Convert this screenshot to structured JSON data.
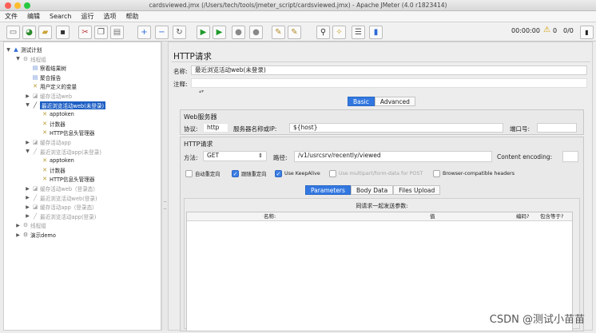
{
  "window": {
    "title": "cardsviewed.jmx (/Users/tech/tools/jmeter_script/cardsviewed.jmx) - Apache JMeter (4.0 r1823414)",
    "traffic_colors": [
      "#fc5f57",
      "#fdbc2e",
      "#28c840"
    ]
  },
  "menu": [
    "文件",
    "编辑",
    "Search",
    "运行",
    "选项",
    "帮助"
  ],
  "toolbar": {
    "buttons": [
      {
        "name": "new-icon",
        "glyph": "▭",
        "color": "#666"
      },
      {
        "name": "templates-icon",
        "glyph": "◕",
        "color": "#2a8a2a"
      },
      {
        "name": "open-icon",
        "glyph": "▰",
        "color": "#c9a233"
      },
      {
        "name": "save-icon",
        "glyph": "▪",
        "color": "#333"
      },
      {
        "name": "cut-icon",
        "glyph": "✂",
        "color": "#b33"
      },
      {
        "name": "copy-icon",
        "glyph": "❐",
        "color": "#555"
      },
      {
        "name": "paste-icon",
        "glyph": "▤",
        "color": "#777"
      },
      {
        "name": "expand-icon",
        "glyph": "+",
        "color": "#2d6bd6"
      },
      {
        "name": "collapse-icon",
        "glyph": "−",
        "color": "#2d6bd6"
      },
      {
        "name": "toggle-icon",
        "glyph": "↻",
        "color": "#555"
      },
      {
        "name": "start-icon",
        "glyph": "▶",
        "color": "#1f9a2a"
      },
      {
        "name": "start-no-pauses-icon",
        "glyph": "▶",
        "color": "#1f9a2a"
      },
      {
        "name": "stop-icon",
        "glyph": "●",
        "color": "#888"
      },
      {
        "name": "shutdown-icon",
        "glyph": "●",
        "color": "#888"
      },
      {
        "name": "clear-icon",
        "glyph": "✎",
        "color": "#b48a2a"
      },
      {
        "name": "clear-all-icon",
        "glyph": "✎",
        "color": "#b48a2a"
      },
      {
        "name": "search-icon",
        "glyph": "⚲",
        "color": "#333"
      },
      {
        "name": "reset-search-icon",
        "glyph": "✧",
        "color": "#c9a233"
      },
      {
        "name": "function-helper-icon",
        "glyph": "☰",
        "color": "#555"
      },
      {
        "name": "help-icon",
        "glyph": "▮",
        "color": "#2d6bd6"
      }
    ],
    "timer": "00:00:00",
    "warning_glyph": "⚠",
    "warning_count": "0",
    "threads": "0/0"
  },
  "tree": [
    {
      "label": "测试计划",
      "level": 0,
      "toggle": "▼",
      "icon": "▲",
      "icon_color": "#2d6bd6"
    },
    {
      "label": "线程组",
      "level": 1,
      "toggle": "▼",
      "icon": "⚙",
      "icon_color": "#999",
      "disabled": true
    },
    {
      "label": "察看结果树",
      "level": 2,
      "toggle": "",
      "icon": "▤",
      "icon_color": "#6b8fd6"
    },
    {
      "label": "聚合报告",
      "level": 2,
      "toggle": "",
      "icon": "▤",
      "icon_color": "#6b8fd6"
    },
    {
      "label": "用户定义的变量",
      "level": 2,
      "toggle": "",
      "icon": "✕",
      "icon_color": "#b89a30"
    },
    {
      "label": "缓存活动web",
      "level": 2,
      "toggle": "▶",
      "icon": "◪",
      "icon_color": "#aaa",
      "disabled": true
    },
    {
      "label": "最近浏览活动web(未登录)",
      "level": 2,
      "toggle": "▼",
      "icon": "╱",
      "icon_color": "#444",
      "selected": true
    },
    {
      "label": "apptoken",
      "level": 3,
      "toggle": "",
      "icon": "✕",
      "icon_color": "#b89a30"
    },
    {
      "label": "计数器",
      "level": 3,
      "toggle": "",
      "icon": "✕",
      "icon_color": "#b89a30"
    },
    {
      "label": "HTTP信息头管理器",
      "level": 3,
      "toggle": "",
      "icon": "✕",
      "icon_color": "#b89a30"
    },
    {
      "label": "缓存活动app",
      "level": 2,
      "toggle": "▶",
      "icon": "◪",
      "icon_color": "#aaa",
      "disabled": true
    },
    {
      "label": "最近浏览活动app(未登录)",
      "level": 2,
      "toggle": "▼",
      "icon": "╱",
      "icon_color": "#aaa",
      "disabled": true
    },
    {
      "label": "apptoken",
      "level": 3,
      "toggle": "",
      "icon": "✕",
      "icon_color": "#b89a30"
    },
    {
      "label": "计数器",
      "level": 3,
      "toggle": "",
      "icon": "✕",
      "icon_color": "#b89a30"
    },
    {
      "label": "HTTP信息头管理器",
      "level": 3,
      "toggle": "",
      "icon": "✕",
      "icon_color": "#b89a30"
    },
    {
      "label": "缓存活动web（登录态）",
      "level": 2,
      "toggle": "▶",
      "icon": "◪",
      "icon_color": "#aaa",
      "disabled": true
    },
    {
      "label": "最近浏览活动web(登录)",
      "level": 2,
      "toggle": "▶",
      "icon": "╱",
      "icon_color": "#aaa",
      "disabled": true
    },
    {
      "label": "缓存活动app（登录态）",
      "level": 2,
      "toggle": "▶",
      "icon": "◪",
      "icon_color": "#aaa",
      "disabled": true
    },
    {
      "label": "最近浏览活动app(登录)",
      "level": 2,
      "toggle": "▶",
      "icon": "╱",
      "icon_color": "#aaa",
      "disabled": true
    },
    {
      "label": "线程组",
      "level": 1,
      "toggle": "▶",
      "icon": "⚙",
      "icon_color": "#999",
      "disabled": true
    },
    {
      "label": "演示demo",
      "level": 1,
      "toggle": "▶",
      "icon": "⚙",
      "icon_color": "#777"
    }
  ],
  "panel": {
    "title": "HTTP请求",
    "name_label": "名称:",
    "name_value": "最近浏览活动web(未登录)",
    "comment_label": "注释:",
    "comment_value": "",
    "tabs": [
      "Basic",
      "Advanced"
    ],
    "web_server": {
      "title": "Web服务器",
      "protocol_label": "协议:",
      "protocol_value": "http",
      "server_label": "服务器名称或IP:",
      "server_value": "${host}",
      "port_label": "端口号:",
      "port_value": ""
    },
    "http_request": {
      "title": "HTTP请求",
      "method_label": "方法:",
      "method_value": "GET",
      "stepper_glyph": "⇕",
      "path_label": "路径:",
      "path_value": "/v1/usrcsrv/recently/viewed",
      "encoding_label": "Content encoding:",
      "encoding_value": ""
    },
    "checkboxes": [
      {
        "label": "自动重定向",
        "checked": false,
        "muted": false
      },
      {
        "label": "跟随重定向",
        "checked": true,
        "muted": false
      },
      {
        "label": "Use KeepAlive",
        "checked": true,
        "muted": false
      },
      {
        "label": "Use multipart/form-data for POST",
        "checked": false,
        "muted": true
      },
      {
        "label": "Browser-compatible headers",
        "checked": false,
        "muted": false
      }
    ],
    "subtabs": [
      "Parameters",
      "Body Data",
      "Files Upload"
    ],
    "params_caption": "同请求一起发送参数:",
    "columns": [
      "名称:",
      "值",
      "编码?",
      "包含等于?"
    ]
  },
  "watermark": "CSDN @测试小苗苗"
}
